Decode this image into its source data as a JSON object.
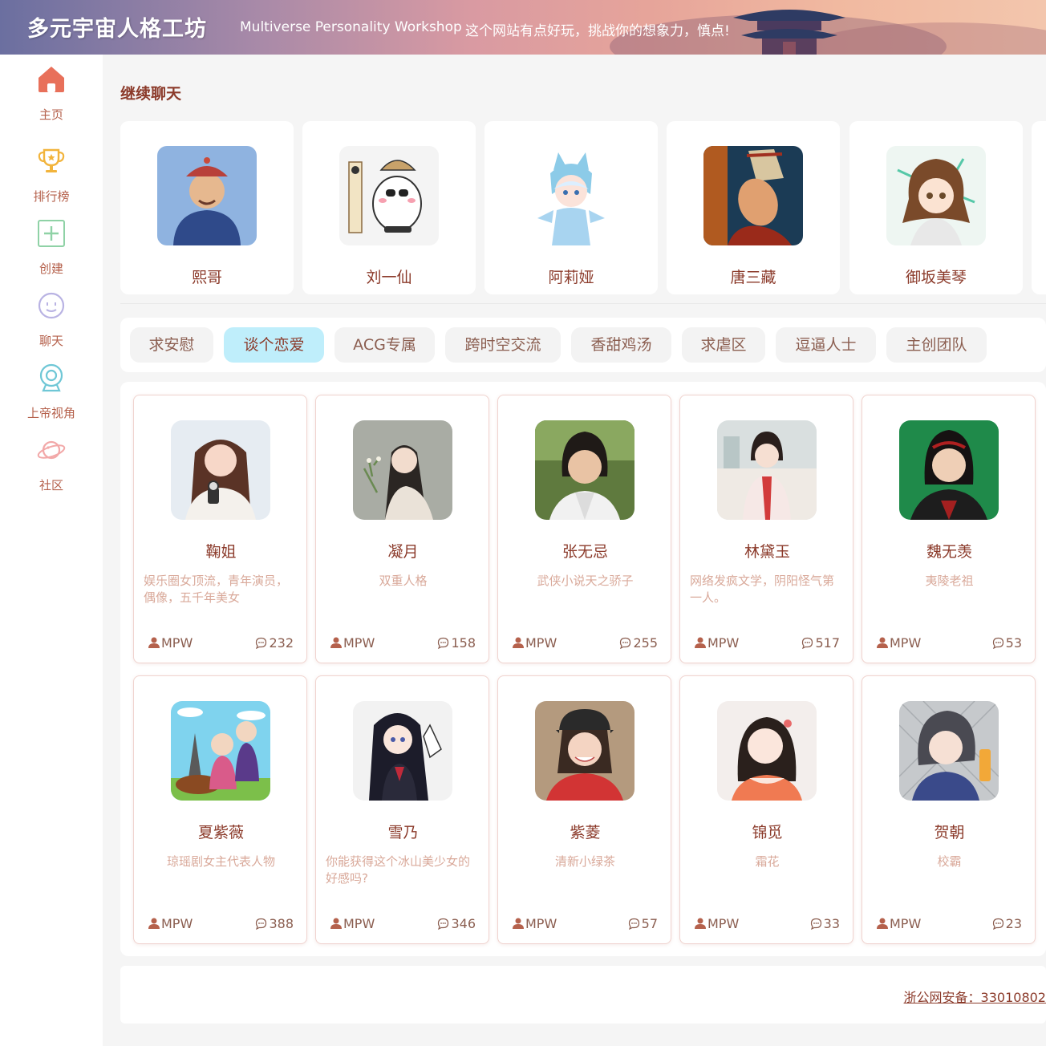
{
  "header": {
    "title": "多元宇宙人格工坊",
    "subtitle": "Multiverse Personality Workshop",
    "slogan": "这个网站有点好玩，挑战你的想象力，慎点!"
  },
  "sidebar": {
    "items": [
      {
        "label": "主页",
        "icon": "home-icon"
      },
      {
        "label": "排行榜",
        "icon": "trophy-icon"
      },
      {
        "label": "创建",
        "icon": "plus-square-icon"
      },
      {
        "label": "聊天",
        "icon": "smile-face-icon"
      },
      {
        "label": "上帝视角",
        "icon": "webcam-icon"
      },
      {
        "label": "社区",
        "icon": "planet-icon"
      }
    ]
  },
  "recent": {
    "title": "继续聊天",
    "items": [
      {
        "name": "熙哥"
      },
      {
        "name": "刘一仙"
      },
      {
        "name": "阿莉娅"
      },
      {
        "name": "唐三藏"
      },
      {
        "name": "御坂美琴"
      }
    ]
  },
  "tabs": {
    "items": [
      "求安慰",
      "谈个恋爱",
      "ACG专属",
      "跨时空交流",
      "香甜鸡汤",
      "求虐区",
      "逗逼人士",
      "主创团队"
    ],
    "active": "谈个恋爱"
  },
  "characters": [
    {
      "name": "鞠姐",
      "desc": "娱乐圈女顶流，青年演员，偶像，五千年美女",
      "author": "MPW",
      "count": "232"
    },
    {
      "name": "凝月",
      "desc": "双重人格",
      "author": "MPW",
      "count": "158"
    },
    {
      "name": "张无忌",
      "desc": "武侠小说天之骄子",
      "author": "MPW",
      "count": "255"
    },
    {
      "name": "林黛玉",
      "desc": "网络发疯文学，阴阳怪气第一人。",
      "author": "MPW",
      "count": "517"
    },
    {
      "name": "魏无羡",
      "desc": "夷陵老祖",
      "author": "MPW",
      "count": "53"
    },
    {
      "name": "夏紫薇",
      "desc": "琼瑶剧女主代表人物",
      "author": "MPW",
      "count": "388"
    },
    {
      "name": "雪乃",
      "desc": "你能获得这个冰山美少女的好感吗?",
      "author": "MPW",
      "count": "346"
    },
    {
      "name": "紫菱",
      "desc": "清新小绿茶",
      "author": "MPW",
      "count": "57"
    },
    {
      "name": "锦觅",
      "desc": "霜花",
      "author": "MPW",
      "count": "33"
    },
    {
      "name": "贺朝",
      "desc": "校霸",
      "author": "MPW",
      "count": "23"
    }
  ],
  "footer": {
    "beian": "浙公网安备：33010802"
  },
  "colors": {
    "accent": "#8b3a2a",
    "tab_active": "#bfeefb",
    "desc": "#d9a99a",
    "home_icon": "#e8705a"
  }
}
